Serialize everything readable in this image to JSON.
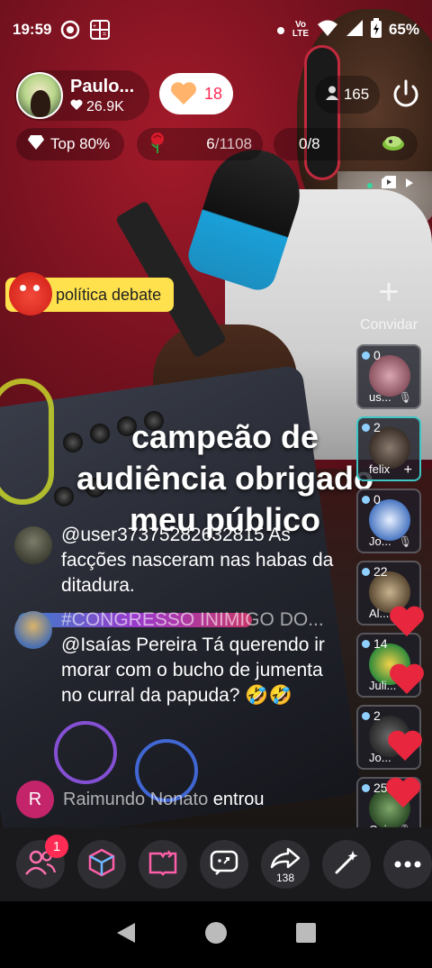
{
  "status_bar": {
    "time": "19:59",
    "network": "Vo LTE",
    "battery": "65%"
  },
  "host": {
    "name": "Paulo...",
    "likes": "26.9K"
  },
  "follow": {
    "count": "18"
  },
  "viewers": {
    "count": "165"
  },
  "badges": {
    "rank": "Top 80%",
    "rose_progress": "6",
    "rose_goal": "/1108",
    "slots": "0/8"
  },
  "topic": {
    "label": "política debate"
  },
  "caption": {
    "line1": "campeão de",
    "line2": "audiência obrigado",
    "line3": "meu público"
  },
  "comments": [
    {
      "name": "",
      "text": "@user37375282632815 As facções nasceram nas habas da ditadura."
    },
    {
      "name": "#CONGRESSO INIMIGO DO...",
      "text": "@Isaías Pereira Tá querendo ir morar com o bucho de jumenta no curral da papuda? 🤣🤣"
    }
  ],
  "join": {
    "initial": "R",
    "name": "Raimundo Nonato",
    "action": "entrou"
  },
  "invite": {
    "label": "Convidar"
  },
  "guests": [
    {
      "count": "0",
      "name": "us..."
    },
    {
      "count": "2",
      "name": "felix"
    },
    {
      "count": "0",
      "name": "Jo..."
    },
    {
      "count": "22",
      "name": "Al..."
    },
    {
      "count": "14",
      "name": "Juli..."
    },
    {
      "count": "2",
      "name": "Jo..."
    },
    {
      "count": "25",
      "name": "Cai..."
    }
  ],
  "toolbar": {
    "notif_count": "1",
    "share_count": "138"
  },
  "colors": {
    "accent": "#fe2c55",
    "topic_bg": "#ffe14d",
    "toolbar_bg": "#1a1a1c"
  }
}
